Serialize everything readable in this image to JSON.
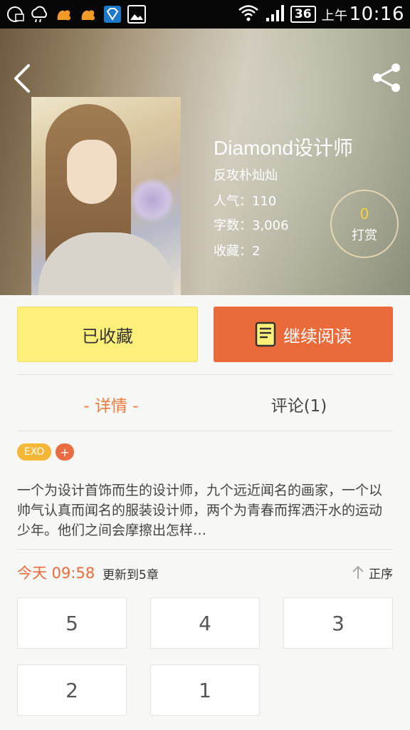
{
  "status_bar": {
    "icons": [
      "notification-icon",
      "weather-icon",
      "uc-browser-icon",
      "uc-browser-icon",
      "diamond-app-icon",
      "image-icon"
    ],
    "battery": "36",
    "time_prefix": "上午",
    "time": "10:16"
  },
  "book": {
    "title": "Diamond设计师",
    "author": "反攻朴灿灿",
    "popularity": "人气：110",
    "word_count": "字数：3,006",
    "favorites": "收藏：2",
    "tip_count": "0",
    "tip_label": "打赏"
  },
  "actions": {
    "favorite_label": "已收藏",
    "read_label": "继续阅读"
  },
  "tabs": {
    "details": "- 详情 -",
    "comments": "评论(1)"
  },
  "tags": [
    "EXO",
    "+"
  ],
  "description": "一个为设计首饰而生的设计师，九个远近闻名的画家，一个以帅气认真而闻名的服装设计师，两个为青春而挥洒汗水的运动少年。他们之间会摩擦出怎样…",
  "update": {
    "time": "今天 09:58",
    "text": "更新到5章",
    "sort_label": "正序"
  },
  "chapters": [
    "5",
    "4",
    "3",
    "2",
    "1"
  ],
  "colors": {
    "accent": "#eb6a3a",
    "favorite_bg": "#fdf07a",
    "tag": "#f6b636"
  }
}
